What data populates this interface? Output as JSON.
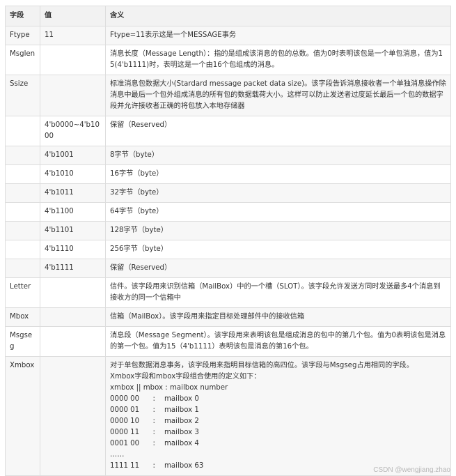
{
  "headers": [
    "字段",
    "值",
    "含义"
  ],
  "rows": [
    {
      "field": "Ftype",
      "value": "11",
      "meaning": "Ftype=11表示这是一个MESSAGE事务"
    },
    {
      "field": "Msglen",
      "value": "",
      "meaning": "消息长度（Message Length）：指的是组成该消息的包的总数。值为0时表明该包是一个单包消息，值为15(4'b1111)时，表明这是一个由16个包组成的消息。"
    },
    {
      "field": "Ssize",
      "value": "",
      "meaning": "标准消息包数据大小(Stardard message packet data size)。该字段告诉消息接收者一个单独消息操作除消息中最后一个包外组成消息的所有包的数据载荷大小。这样可以防止发送者过度延长最后一个包的数据字段并允许接收者正确的将包放入本地存储器"
    },
    {
      "field": "",
      "value": "4'b0000~4'b1000",
      "meaning": "保留（Reserved）"
    },
    {
      "field": "",
      "value": "4'b1001",
      "meaning": "8字节（byte）"
    },
    {
      "field": "",
      "value": "4'b1010",
      "meaning": "16字节（byte）"
    },
    {
      "field": "",
      "value": "4'b1011",
      "meaning": "32字节（byte）"
    },
    {
      "field": "",
      "value": "4'b1100",
      "meaning": "64字节（byte）"
    },
    {
      "field": "",
      "value": "4'b1101",
      "meaning": "128字节（byte）"
    },
    {
      "field": "",
      "value": "4'b1110",
      "meaning": "256字节（byte）"
    },
    {
      "field": "",
      "value": "4'b1111",
      "meaning": "保留（Reserved）"
    },
    {
      "field": "Letter",
      "value": "",
      "meaning": "信件。该字段用来识别信箱（MailBox）中的一个槽（SLOT）。该字段允许发送方同时发送最多4个消息到接收方的同一个信箱中"
    },
    {
      "field": "Mbox",
      "value": "",
      "meaning": "信箱（MailBox）。该字段用来指定目标处理部件中的接收信箱"
    },
    {
      "field": "Msgseg",
      "value": "",
      "meaning": "消息段（Message Segment）。该字段用来表明该包是组成消息的包中的第几个包。值为0表明该包是消息的第一个包。值为15（4'b1111）表明该包是消息的第16个包。"
    },
    {
      "field": "Xmbox",
      "value": "",
      "meaning_lines": [
        "对于单包数据消息事务，该字段用来指明目标信箱的高四位。该字段与Msgseg占用相同的字段。",
        "Xmbox字段和mbox字段组合使用的定义如下：",
        "xmbox || mbox : mailbox number",
        "0000 00      :    mailbox 0",
        "0000 01      :    mailbox 1",
        "0000 10      :    mailbox 2",
        "0000 11      :    mailbox 3",
        "0001 00      :    mailbox 4",
        "……",
        "1111 11      :    mailbox 63"
      ]
    }
  ],
  "watermark": "CSDN @wengjiang.zhao"
}
